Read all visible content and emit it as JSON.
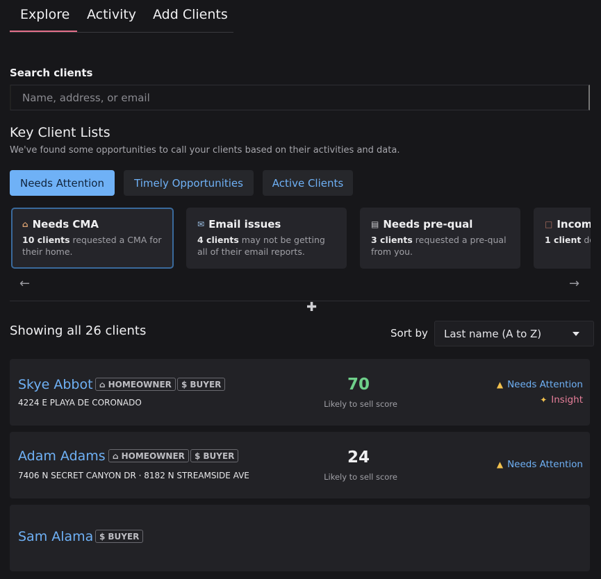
{
  "tabs": [
    {
      "label": "Explore"
    },
    {
      "label": "Activity"
    },
    {
      "label": "Add Clients"
    }
  ],
  "search": {
    "label": "Search clients",
    "placeholder": "Name, address, or email"
  },
  "key_lists": {
    "title": "Key Client Lists",
    "subtitle": "We've found some opportunities to call your clients based on their activities and data.",
    "pills": [
      {
        "label": "Needs Attention"
      },
      {
        "label": "Timely Opportunities"
      },
      {
        "label": "Active Clients"
      }
    ],
    "cards": [
      {
        "icon": "house-icon",
        "title": "Needs CMA",
        "count": "10 clients",
        "text": " requested a CMA for their home."
      },
      {
        "icon": "mail-icon",
        "title": "Email issues",
        "count": "4 clients",
        "text": " may not be getting all of their email reports."
      },
      {
        "icon": "document-icon",
        "title": "Needs pre-qual",
        "count": "3 clients",
        "text": " requested a pre-qual from you."
      },
      {
        "icon": "profile-icon",
        "title": "Incom",
        "count": "1 client",
        "text": " doe profile infor"
      }
    ],
    "prev_arrow": "←",
    "next_arrow": "→"
  },
  "list": {
    "showing": "Showing all 26 clients",
    "sort_label": "Sort by",
    "sort_value": "Last name (A to Z)"
  },
  "clients": [
    {
      "name": "Skye Abbot",
      "tags": [
        "HOMEOWNER",
        "BUYER"
      ],
      "address": "4224 E PLAYA DE CORONADO",
      "score": "70",
      "score_label": "Likely to sell score",
      "status1": "Needs Attention",
      "status2": "Insight"
    },
    {
      "name": "Adam Adams",
      "tags": [
        "HOMEOWNER",
        "BUYER"
      ],
      "address": "7406 N SECRET CANYON DR · 8182 N STREAMSIDE AVE",
      "score": "24",
      "score_label": "Likely to sell score",
      "status1": "Needs Attention"
    },
    {
      "name": "Sam Alama",
      "tags": [
        "BUYER"
      ]
    }
  ],
  "colors": {
    "accent": "#6fb1f6",
    "tab_underline": "#e46f8a",
    "score_high": "#6fd08a",
    "insight": "#e77f9a"
  }
}
